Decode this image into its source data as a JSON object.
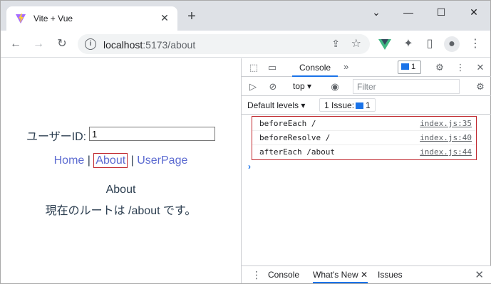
{
  "browser": {
    "tab_title": "Vite + Vue",
    "url_host": "localhost",
    "url_path": ":5173/about"
  },
  "page": {
    "userid_label": "ユーザーID:",
    "userid_value": "1",
    "nav": {
      "home": "Home",
      "sep1": " | ",
      "about": "About",
      "sep2": " | ",
      "userpage": "UserPage"
    },
    "heading": "About",
    "route_text": "現在のルートは /about です。"
  },
  "devtools": {
    "tab_console": "Console",
    "issues_count_badge": "1",
    "context": "top",
    "filter_placeholder": "Filter",
    "levels": "Default levels",
    "issues_button": "1 Issue:",
    "issues_button_count": "1",
    "logs": [
      {
        "message": "beforeEach /",
        "source": "index.js:35"
      },
      {
        "message": "beforeResolve /",
        "source": "index.js:40"
      },
      {
        "message": "afterEach /about",
        "source": "index.js:44"
      }
    ],
    "drawer": {
      "console": "Console",
      "whats_new": "What's New",
      "issues": "Issues"
    }
  },
  "colors": {
    "link": "#5c6bd1",
    "accent": "#1a73e8",
    "highlight": "#c0272d"
  }
}
